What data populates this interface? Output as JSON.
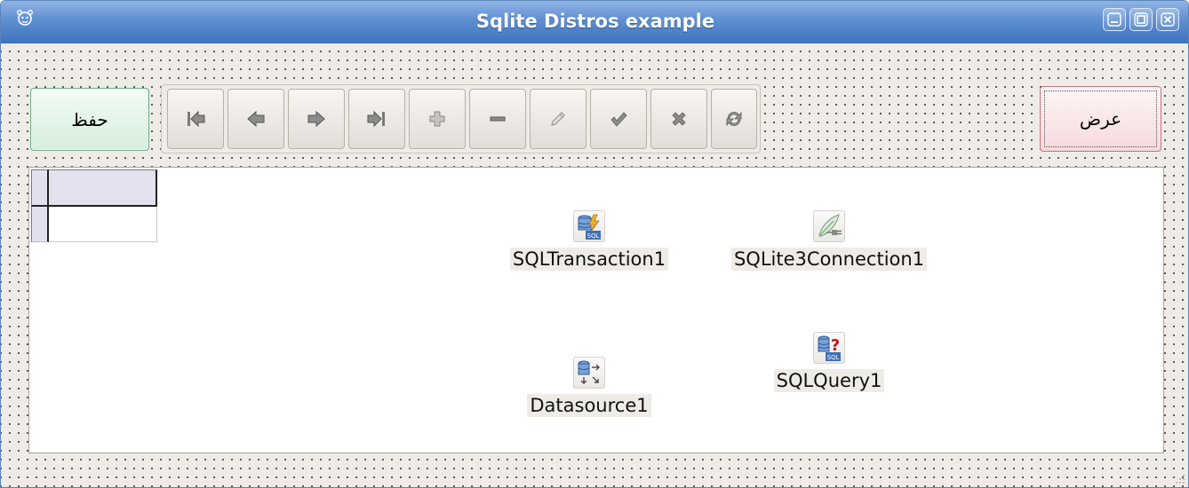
{
  "window": {
    "title": "Sqlite Distros example",
    "app_icon": "lazarus-paw-icon",
    "buttons": [
      "minimize",
      "maximize",
      "close"
    ]
  },
  "toolbar": {
    "save_label": "حفظ",
    "show_label": "عرض"
  },
  "navigator": {
    "buttons": [
      {
        "name": "first",
        "icon": "first-record-icon"
      },
      {
        "name": "prior",
        "icon": "prior-record-icon"
      },
      {
        "name": "next",
        "icon": "next-record-icon"
      },
      {
        "name": "last",
        "icon": "last-record-icon"
      },
      {
        "name": "insert",
        "icon": "plus-icon"
      },
      {
        "name": "delete",
        "icon": "minus-icon"
      },
      {
        "name": "edit",
        "icon": "pencil-icon"
      },
      {
        "name": "post",
        "icon": "checkmark-icon"
      },
      {
        "name": "cancel",
        "icon": "cross-icon"
      },
      {
        "name": "refresh",
        "icon": "refresh-icon"
      }
    ]
  },
  "components": {
    "transaction": {
      "label": "SQLTransaction1",
      "icon": "sql-transaction-icon"
    },
    "connection": {
      "label": "SQLite3Connection1",
      "icon": "connection-plug-icon"
    },
    "datasource": {
      "label": "Datasource1",
      "icon": "datasource-icon"
    },
    "query": {
      "label": "SQLQuery1",
      "icon": "sql-query-icon"
    }
  },
  "colors": {
    "titlebar": "#5f8fd0",
    "form_bg": "#efebe7",
    "save_button": "#d6eedd",
    "show_button": "#f6d9dc"
  }
}
